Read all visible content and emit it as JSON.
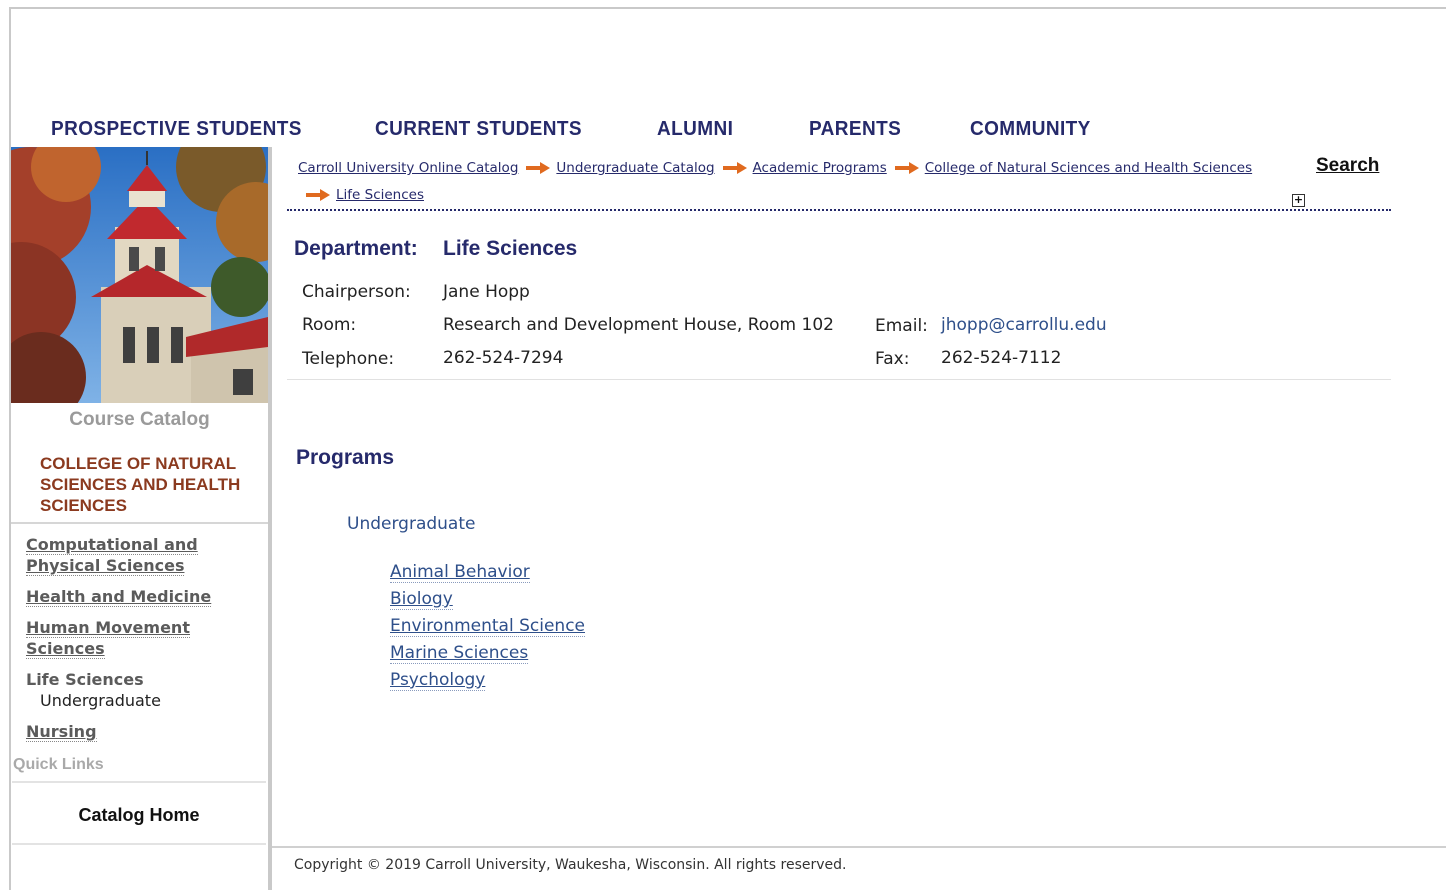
{
  "topnav": [
    "PROSPECTIVE STUDENTS",
    "CURRENT STUDENTS",
    "ALUMNI",
    "PARENTS",
    "COMMUNITY"
  ],
  "sidebar": {
    "title": "Course Catalog",
    "college": "COLLEGE OF NATURAL SCIENCES AND HEALTH SCIENCES",
    "links": [
      "Computational and Physical Sciences",
      "Health and Medicine",
      "Human Movement Sciences",
      "Life Sciences",
      "Undergraduate",
      "Nursing"
    ],
    "quick_links_label": "Quick Links",
    "catalog_home": "Catalog Home"
  },
  "breadcrumb": [
    "Carroll University Online Catalog",
    "Undergraduate Catalog",
    "Academic Programs",
    "College of Natural Sciences and Health Sciences",
    "Life Sciences"
  ],
  "search_label": "Search",
  "expand_symbol": "+",
  "department": {
    "label": "Department:",
    "name": "Life Sciences",
    "chair_label": "Chairperson:",
    "chair": "Jane Hopp",
    "room_label": "Room:",
    "room": "Research and Development House, Room 102",
    "email_label": "Email:",
    "email": "jhopp@carrollu.edu",
    "phone_label": "Telephone:",
    "phone": "262-524-7294",
    "fax_label": "Fax:",
    "fax": "262-524-7112"
  },
  "programs": {
    "heading": "Programs",
    "level": "Undergraduate",
    "items": [
      "Animal Behavior",
      "Biology",
      "Environmental Science",
      "Marine Sciences",
      "Psychology"
    ]
  },
  "footer": "Copyright © 2019 Carroll University, Waukesha, Wisconsin. All rights reserved.",
  "colors": {
    "navy": "#262a6b",
    "link": "#2e4f8a",
    "college": "#8b3a1f",
    "arrow": "#e06a1f"
  }
}
